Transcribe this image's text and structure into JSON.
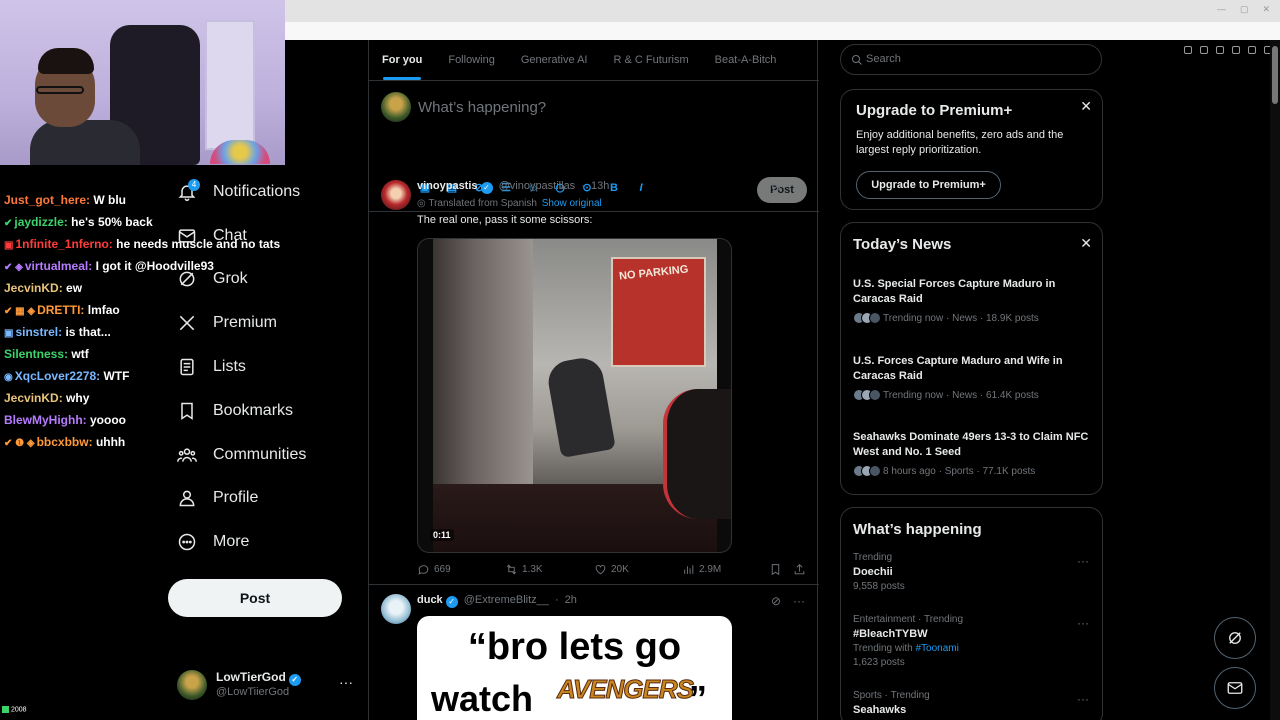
{
  "chat": [
    {
      "badges": "",
      "user": "Just_got_here",
      "color": "#ff7a3a",
      "message": "W blu"
    },
    {
      "badges": "✔",
      "user": "jaydizzle",
      "color": "#3bd46a",
      "message": "he's 50% back"
    },
    {
      "badges": "▣",
      "user": "1nfinite_1nferno",
      "color": "#ff3b3b",
      "message": "he needs muscle and no tats"
    },
    {
      "badges": "✔ ◈",
      "user": "virtualmeal",
      "color": "#b67cff",
      "message": "I got it @Hoodville93"
    },
    {
      "badges": "",
      "user": "JecvinKD",
      "color": "#e8c47a",
      "message": "ew"
    },
    {
      "badges": "✔ ▦ ◈",
      "user": "DRETTI",
      "color": "#ff9a3a",
      "message": "lmfao"
    },
    {
      "badges": "▣",
      "user": "sinstrel",
      "color": "#7ab8ff",
      "message": "is that..."
    },
    {
      "badges": "",
      "user": "Silentness",
      "color": "#3bd46a",
      "message": "wtf"
    },
    {
      "badges": "◉",
      "user": "XqcLover2278",
      "color": "#7ab8ff",
      "message": "WTF"
    },
    {
      "badges": "",
      "user": "JecvinKD",
      "color": "#e8c47a",
      "message": "why"
    },
    {
      "badges": "",
      "user": "BlewMyHighh",
      "color": "#b67cff",
      "message": "yoooo"
    },
    {
      "badges": "✔ ❶ ◈",
      "user": "bbcxbbw",
      "color": "#ff9a3a",
      "message": "uhhh"
    }
  ],
  "chat_footer": "2008",
  "nav": {
    "items": [
      {
        "label": "Notifications",
        "badge": "4"
      },
      {
        "label": "Chat"
      },
      {
        "label": "Grok"
      },
      {
        "label": "Premium"
      },
      {
        "label": "Lists"
      },
      {
        "label": "Bookmarks"
      },
      {
        "label": "Communities"
      },
      {
        "label": "Profile"
      },
      {
        "label": "More"
      }
    ],
    "post_label": "Post"
  },
  "account": {
    "name": "LowTierGod",
    "handle": "@LowTiierGod",
    "more": "···"
  },
  "tabs": [
    "For you",
    "Following",
    "Generative AI",
    "R & C Futurism",
    "Beat-A-Bitch"
  ],
  "composer": {
    "placeholder": "What’s happening?",
    "post_label": "Post"
  },
  "tweet1": {
    "name": "vinoypastis",
    "handle": "@vinoypastillas",
    "time": "13h",
    "translated": "Translated from Spanish",
    "show_original": "Show original",
    "text": "The real one, pass it some scissors:",
    "video_time": "0:11",
    "video_sign": "NO PARKING",
    "replies": "669",
    "reposts": "1.3K",
    "likes": "20K",
    "views": "2.9M"
  },
  "tweet2": {
    "name": "duck",
    "handle": "@ExtremeBlitz__",
    "time": "2h",
    "meme_line1": "“bro lets go",
    "meme_line2": "watch",
    "meme_brand": "AVENGERS",
    "meme_close": "”"
  },
  "search": {
    "placeholder": "Search"
  },
  "premium": {
    "title": "Upgrade to Premium+",
    "body": "Enjoy additional benefits, zero ads and the largest reply prioritization.",
    "button": "Upgrade to Premium+"
  },
  "news": {
    "title": "Today’s News",
    "items": [
      {
        "title": "U.S. Special Forces Capture Maduro in Caracas Raid",
        "meta": "Trending now · News · 18.9K posts"
      },
      {
        "title": "U.S. Forces Capture Maduro and Wife in Caracas Raid",
        "meta": "Trending now · News · 61.4K posts"
      },
      {
        "title": "Seahawks Dominate 49ers 13-3 to Claim NFC West and No. 1 Seed",
        "meta": "8 hours ago · Sports · 77.1K posts"
      }
    ]
  },
  "happening": {
    "title": "What’s happening",
    "items": [
      {
        "context": "Trending",
        "title": "Doechii",
        "posts": "9,558 posts"
      },
      {
        "context": "Entertainment · Trending",
        "title": "#BleachTYBW",
        "with_prefix": "Trending with",
        "with_tag": "#Toonami",
        "posts": "1,623 posts"
      },
      {
        "context": "Sports · Trending",
        "title": "Seahawks",
        "posts": ""
      }
    ]
  },
  "colors": {
    "accent": "#1d9bf0",
    "background": "#000000",
    "border": "#2f3336",
    "muted": "#71767b"
  }
}
